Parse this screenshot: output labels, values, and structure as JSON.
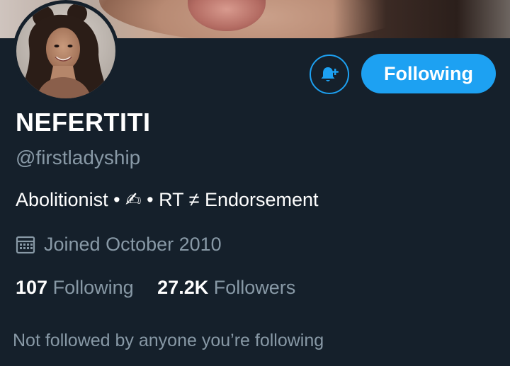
{
  "profile": {
    "display_name": "NEFERTITI",
    "handle": "@firstladyship",
    "bio": "Abolitionist  •  ✍  • RT ≠ Endorsement",
    "joined": "Joined October 2010",
    "following_count": "107",
    "following_label": "Following",
    "followers_count": "27.2K",
    "followers_label": "Followers",
    "not_followed_note": "Not followed by anyone you’re following"
  },
  "actions": {
    "follow_button_label": "Following",
    "notify_icon": "bell-plus-icon"
  },
  "icons": {
    "calendar": "calendar-icon"
  },
  "colors": {
    "background": "#15202b",
    "accent": "#1da1f2",
    "secondary_text": "#8899a6",
    "primary_text": "#ffffff"
  }
}
